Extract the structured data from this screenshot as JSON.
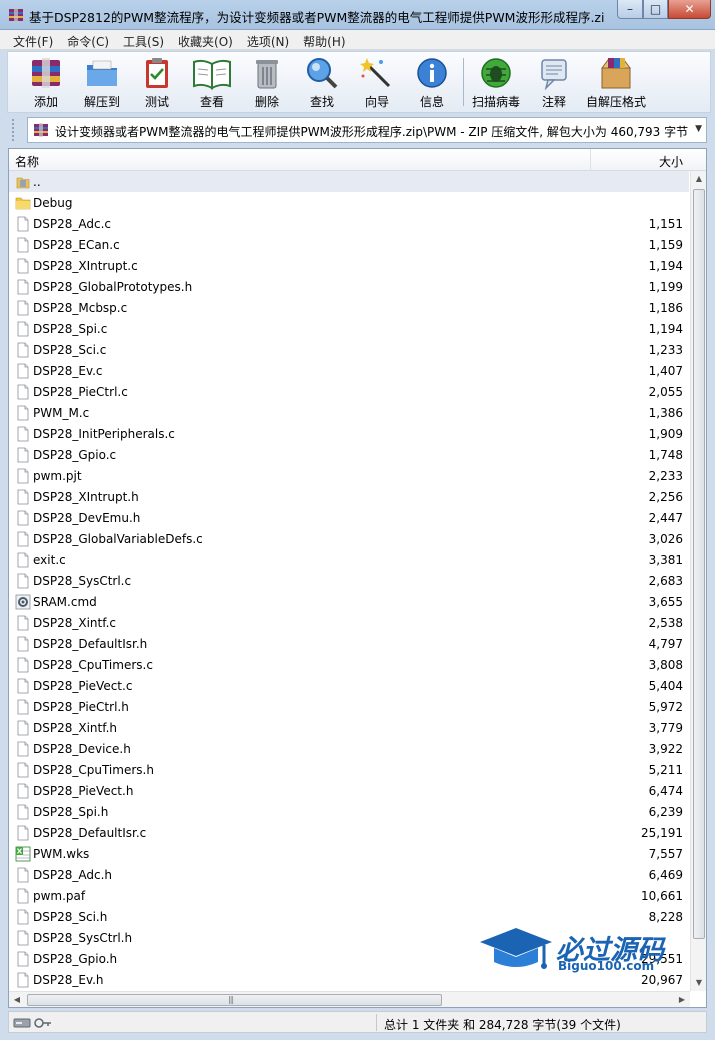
{
  "window": {
    "title": "基于DSP2812的PWM整流程序，为设计变频器或者PWM整流器的电气工程师提供PWM波形形成程序.zi...",
    "minimize": "–",
    "maximize": "□",
    "close": "✕"
  },
  "menu": [
    "文件(F)",
    "命令(C)",
    "工具(S)",
    "收藏夹(O)",
    "选项(N)",
    "帮助(H)"
  ],
  "toolbar": {
    "add": "添加",
    "extract": "解压到",
    "test": "测试",
    "view": "查看",
    "delete": "删除",
    "find": "查找",
    "wizard": "向导",
    "info": "信息",
    "virus": "扫描病毒",
    "comment": "注释",
    "sfx": "自解压格式"
  },
  "address": {
    "path": "设计变频器或者PWM整流器的电气工程师提供PWM波形形成程序.zip\\PWM - ZIP 压缩文件, 解包大小为 460,793 字节"
  },
  "columns": {
    "name": "名称",
    "size": "大小"
  },
  "files": [
    {
      "name": "..",
      "size": "",
      "type": "up"
    },
    {
      "name": "Debug",
      "size": "",
      "type": "folder"
    },
    {
      "name": "DSP28_Adc.c",
      "size": "1,151",
      "type": "file"
    },
    {
      "name": "DSP28_ECan.c",
      "size": "1,159",
      "type": "file"
    },
    {
      "name": "DSP28_XIntrupt.c",
      "size": "1,194",
      "type": "file"
    },
    {
      "name": "DSP28_GlobalPrototypes.h",
      "size": "1,199",
      "type": "file"
    },
    {
      "name": "DSP28_Mcbsp.c",
      "size": "1,186",
      "type": "file"
    },
    {
      "name": "DSP28_Spi.c",
      "size": "1,194",
      "type": "file"
    },
    {
      "name": "DSP28_Sci.c",
      "size": "1,233",
      "type": "file"
    },
    {
      "name": "DSP28_Ev.c",
      "size": "1,407",
      "type": "file"
    },
    {
      "name": "DSP28_PieCtrl.c",
      "size": "2,055",
      "type": "file"
    },
    {
      "name": "PWM_M.c",
      "size": "1,386",
      "type": "file"
    },
    {
      "name": "DSP28_InitPeripherals.c",
      "size": "1,909",
      "type": "file"
    },
    {
      "name": "DSP28_Gpio.c",
      "size": "1,748",
      "type": "file"
    },
    {
      "name": "pwm.pjt",
      "size": "2,233",
      "type": "file"
    },
    {
      "name": "DSP28_XIntrupt.h",
      "size": "2,256",
      "type": "file"
    },
    {
      "name": "DSP28_DevEmu.h",
      "size": "2,447",
      "type": "file"
    },
    {
      "name": "DSP28_GlobalVariableDefs.c",
      "size": "3,026",
      "type": "file"
    },
    {
      "name": "exit.c",
      "size": "3,381",
      "type": "file"
    },
    {
      "name": "DSP28_SysCtrl.c",
      "size": "2,683",
      "type": "file"
    },
    {
      "name": "SRAM.cmd",
      "size": "3,655",
      "type": "cmd"
    },
    {
      "name": "DSP28_Xintf.c",
      "size": "2,538",
      "type": "file"
    },
    {
      "name": "DSP28_DefaultIsr.h",
      "size": "4,797",
      "type": "file"
    },
    {
      "name": "DSP28_CpuTimers.c",
      "size": "3,808",
      "type": "file"
    },
    {
      "name": "DSP28_PieVect.c",
      "size": "5,404",
      "type": "file"
    },
    {
      "name": "DSP28_PieCtrl.h",
      "size": "5,972",
      "type": "file"
    },
    {
      "name": "DSP28_Xintf.h",
      "size": "3,779",
      "type": "file"
    },
    {
      "name": "DSP28_Device.h",
      "size": "3,922",
      "type": "file"
    },
    {
      "name": "DSP28_CpuTimers.h",
      "size": "5,211",
      "type": "file"
    },
    {
      "name": "DSP28_PieVect.h",
      "size": "6,474",
      "type": "file"
    },
    {
      "name": "DSP28_Spi.h",
      "size": "6,239",
      "type": "file"
    },
    {
      "name": "DSP28_DefaultIsr.c",
      "size": "25,191",
      "type": "file"
    },
    {
      "name": "PWM.wks",
      "size": "7,557",
      "type": "wks"
    },
    {
      "name": "DSP28_Adc.h",
      "size": "6,469",
      "type": "file"
    },
    {
      "name": "pwm.paf",
      "size": "10,661",
      "type": "file"
    },
    {
      "name": "DSP28_Sci.h",
      "size": "8,228",
      "type": "file"
    },
    {
      "name": "DSP28_SysCtrl.h",
      "size": "",
      "type": "file"
    },
    {
      "name": "DSP28_Gpio.h",
      "size": "29,551",
      "type": "file"
    },
    {
      "name": "DSP28_Ev.h",
      "size": "20,967",
      "type": "file"
    }
  ],
  "status": {
    "summary": "总计 1 文件夹 和 284,728 字节(39 个文件)"
  },
  "watermark": {
    "title": "必过源码",
    "url": "Biguo100.com"
  }
}
